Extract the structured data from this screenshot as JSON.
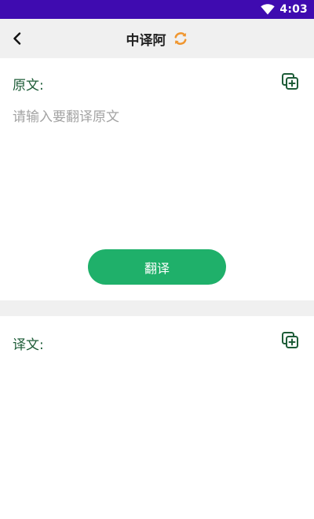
{
  "status_bar": {
    "time": "4:03",
    "icons": [
      "wifi-icon"
    ],
    "background": "#3f0bb0"
  },
  "header": {
    "title": "中译阿",
    "back_icon": "chevron-left-icon",
    "swap_icon": "swap-icon"
  },
  "source": {
    "label": "原文:",
    "placeholder": "请输入要翻译原文",
    "value": "",
    "copy_icon": "copy-icon"
  },
  "translate_button": {
    "label": "翻译",
    "color": "#1fb06a"
  },
  "result": {
    "label": "译文:",
    "value": "",
    "copy_icon": "copy-icon"
  },
  "colors": {
    "accent_green": "#1fb06a",
    "label_green": "#1d5c37",
    "swap_orange": "#f0962f",
    "app_bar_bg": "#f0f0f0"
  }
}
